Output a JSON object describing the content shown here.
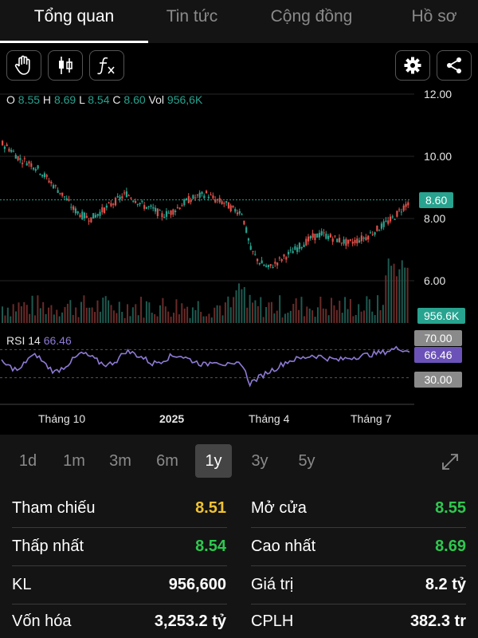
{
  "tabs": [
    {
      "label": "Tổng quan",
      "active": true
    },
    {
      "label": "Tin tức",
      "active": false
    },
    {
      "label": "Cộng đồng",
      "active": false
    },
    {
      "label": "Hồ sơ",
      "active": false
    }
  ],
  "toolbar": {
    "left_icons": [
      "hand-pan-icon",
      "candlestick-icon",
      "function-icon"
    ],
    "right_icons": [
      "gear-icon",
      "share-icon"
    ]
  },
  "ohlc": {
    "o_label": "O",
    "o": "8.55",
    "h_label": "H",
    "h": "8.69",
    "l_label": "L",
    "l": "8.54",
    "c_label": "C",
    "c": "8.60",
    "vol_label": "Vol",
    "vol": "956,6K"
  },
  "price_axis": [
    "12.00",
    "10.00",
    "8.00",
    "6.00"
  ],
  "last_price_tag": "8.60",
  "volume_tag": "956.6K",
  "rsi": {
    "label": "RSI 14",
    "value": "66.46",
    "upper_tag": "70.00",
    "value_tag": "66.46",
    "lower_tag": "30.00"
  },
  "x_axis": [
    {
      "label": "Tháng 10",
      "bold": false
    },
    {
      "label": "2025",
      "bold": true
    },
    {
      "label": "Tháng 4",
      "bold": false
    },
    {
      "label": "Tháng 7",
      "bold": false
    }
  ],
  "ranges": [
    {
      "label": "1d",
      "active": false
    },
    {
      "label": "1m",
      "active": false
    },
    {
      "label": "3m",
      "active": false
    },
    {
      "label": "6m",
      "active": false
    },
    {
      "label": "1y",
      "active": true
    },
    {
      "label": "3y",
      "active": false
    },
    {
      "label": "5y",
      "active": false
    }
  ],
  "stats": {
    "ref_label": "Tham chiếu",
    "ref_value": "8.51",
    "open_label": "Mở cửa",
    "open_value": "8.55",
    "low_label": "Thấp nhất",
    "low_value": "8.54",
    "high_label": "Cao nhất",
    "high_value": "8.69",
    "vol_label": "KL",
    "vol_value": "956,600",
    "turnover_label": "Giá trị",
    "turnover_value": "8.2 tỷ",
    "mcap_label": "Vốn hóa",
    "mcap_value": "3,253.2 tỷ",
    "shares_label": "CPLH",
    "shares_value": "382.3 tr"
  },
  "colors": {
    "up": "#27a38f",
    "down": "#e0504a",
    "reference": "#f0c232",
    "rsi_line": "#8f7ad6",
    "positive_value": "#2ec84f"
  },
  "chart_data": {
    "type": "line",
    "x": [
      "Tháng 10",
      "2025",
      "Tháng 4",
      "Tháng 7"
    ],
    "price_ylim": [
      5.0,
      12.0
    ],
    "series": [
      {
        "values": [
          10.4,
          10.2,
          9.9,
          9.8,
          9.6,
          9.3,
          9.0,
          8.7,
          8.3,
          8.1,
          8.0,
          8.2,
          8.4,
          8.6,
          8.8,
          8.6,
          8.4,
          8.3,
          8.1,
          8.2,
          8.4,
          8.6,
          8.7,
          8.8,
          8.6,
          8.5,
          8.3,
          8.2,
          7.0,
          6.6,
          6.4,
          6.6,
          6.8,
          7.0,
          7.2,
          7.4,
          7.5,
          7.4,
          7.3,
          7.2,
          7.3,
          7.4,
          7.6,
          7.8,
          8.0,
          8.3,
          8.6
        ]
      },
      {
        "values": [
          52,
          45,
          40,
          58,
          62,
          48,
          38,
          45,
          55,
          65,
          60,
          52,
          48,
          55,
          68,
          64,
          58,
          50,
          54,
          60,
          62,
          57,
          52,
          48,
          55,
          50,
          46,
          52,
          22,
          30,
          38,
          44,
          52,
          56,
          58,
          62,
          60,
          57,
          55,
          58,
          60,
          62,
          64,
          66,
          70,
          72,
          66.46
        ]
      }
    ],
    "rsi_levels": [
      70,
      30
    ],
    "grid": true
  }
}
